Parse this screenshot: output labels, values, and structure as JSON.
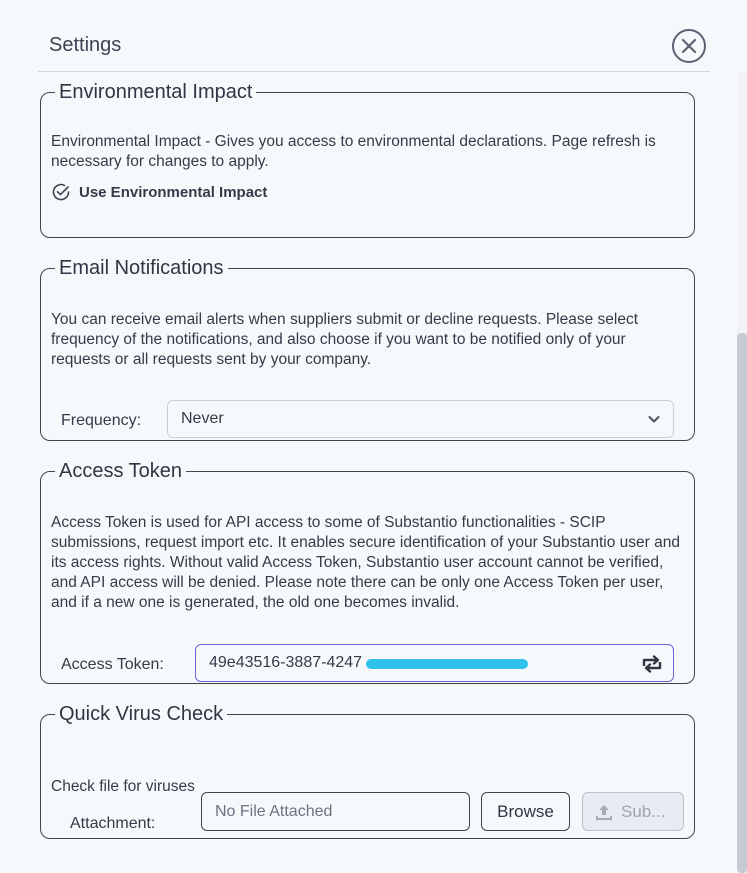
{
  "header": {
    "title": "Settings",
    "close_icon": "close-circle-icon"
  },
  "environmental": {
    "legend": "Environmental Impact",
    "description": "Environmental Impact - Gives you access to environmental declarations. Page refresh is necessary for changes to apply.",
    "checkbox_label": "Use Environmental Impact",
    "checkbox_icon": "check-circle-icon",
    "checked": true
  },
  "email": {
    "legend": "Email Notifications",
    "description": "You can receive email alerts when suppliers submit or decline requests. Please select frequency of the notifications, and also choose if you want to be notified only of your requests or all requests sent by your company.",
    "frequency_label": "Frequency:",
    "frequency_value": "Never"
  },
  "token": {
    "legend": "Access Token",
    "description": "Access Token is used for API access to some of Substantio functionalities - SCIP submissions, request import etc. It enables secure identification of your Substantio user and its access rights. Without valid Access Token, Substantio user account cannot be verified, and API access will be denied. Please note there can be only one Access Token per user, and if a new one is generated, the old one becomes invalid.",
    "label": "Access Token:",
    "value": "49e43516-3887-4247",
    "refresh_icon": "refresh-icon"
  },
  "virus": {
    "legend": "Quick Virus Check",
    "description": "Check file for viruses",
    "attachment_label": "Attachment:",
    "file_placeholder": "No File Attached",
    "browse_label": "Browse",
    "submit_label": "Sub..."
  },
  "colors": {
    "accent": "#6c63d8",
    "redaction": "#2fc0ec",
    "border": "#3e4552"
  }
}
